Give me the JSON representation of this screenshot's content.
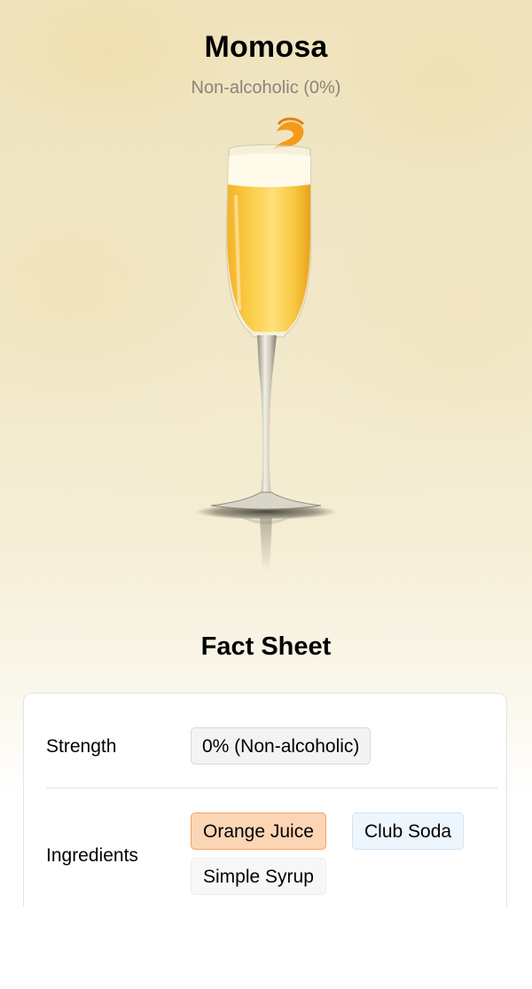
{
  "drink": {
    "name": "Momosa",
    "strength_subtitle": "Non-alcoholic (0%)"
  },
  "fact_sheet": {
    "title": "Fact Sheet",
    "strength": {
      "label": "Strength",
      "value": "0% (Non-alcoholic)"
    },
    "ingredients": {
      "label": "Ingredients",
      "items": [
        "Orange Juice",
        "Club Soda",
        "Simple Syrup"
      ]
    }
  },
  "colors": {
    "chip_orange_bg": "#fcd6b4",
    "chip_orange_border": "#f0a26a",
    "chip_blue_bg": "#eef6fd",
    "chip_gray_bg": "#f3f3f3"
  }
}
